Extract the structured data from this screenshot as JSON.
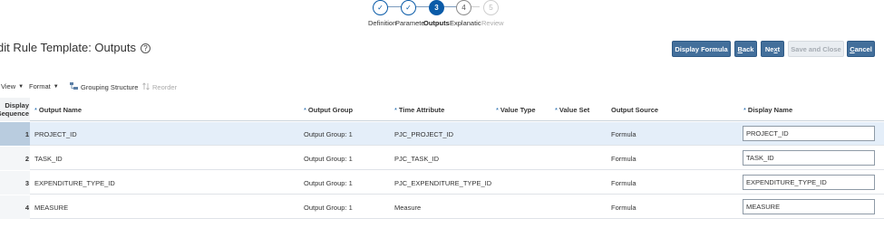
{
  "train": {
    "stops": [
      {
        "symbol": "✓",
        "label": "Definition",
        "state": "done"
      },
      {
        "symbol": "✓",
        "label": "Parameters",
        "state": "done"
      },
      {
        "symbol": "3",
        "label": "Outputs",
        "state": "current"
      },
      {
        "symbol": "4",
        "label": "Explanatio",
        "state": "future"
      },
      {
        "symbol": "5",
        "label": "Review",
        "state": "disabled"
      }
    ],
    "visible_labels": [
      "Definition",
      "Paramete",
      "Outputs",
      "Explanatic",
      "Review"
    ]
  },
  "header": {
    "title": "dit Rule Template: Outputs",
    "help_icon": "?"
  },
  "buttons": {
    "display_formula": "Display Formula",
    "back_prefix": "B",
    "back_rest": "ack",
    "next_prefix": "Ne",
    "next_acc": "x",
    "next_rest": "t",
    "save_close": "Save and Close",
    "cancel_prefix": "C",
    "cancel_rest": "ancel"
  },
  "toolbar": {
    "view": "View",
    "format": "Format",
    "grouping": "Grouping Structure",
    "reorder": "Reorder",
    "grouping_icon": "grouping-icon",
    "reorder_icon": "reorder-icon"
  },
  "table": {
    "columns": {
      "display_seq_1": "Display",
      "display_seq_2": "Sequence",
      "output_name": "Output Name",
      "output_group": "Output Group",
      "time_attribute": "Time Attribute",
      "value_type": "Value Type",
      "value_set": "Value Set",
      "output_source": "Output Source",
      "display_name": "Display Name"
    },
    "rows": [
      {
        "seq": "1",
        "name": "PROJECT_ID",
        "group": "Output Group: 1",
        "time": "PJC_PROJECT_ID",
        "source": "Formula",
        "display": "PROJECT_ID"
      },
      {
        "seq": "2",
        "name": "TASK_ID",
        "group": "Output Group: 1",
        "time": "PJC_TASK_ID",
        "source": "Formula",
        "display": "TASK_ID"
      },
      {
        "seq": "3",
        "name": "EXPENDITURE_TYPE_ID",
        "group": "Output Group: 1",
        "time": "PJC_EXPENDITURE_TYPE_ID",
        "source": "Formula",
        "display": "EXPENDITURE_TYPE_ID"
      },
      {
        "seq": "4",
        "name": "MEASURE",
        "group": "Output Group: 1",
        "time": "Measure",
        "source": "Formula",
        "display": "MEASURE"
      }
    ]
  },
  "colors": {
    "accent": "#0a5ba8",
    "button": "#436f9b",
    "selected_row": "#e4eef9"
  }
}
